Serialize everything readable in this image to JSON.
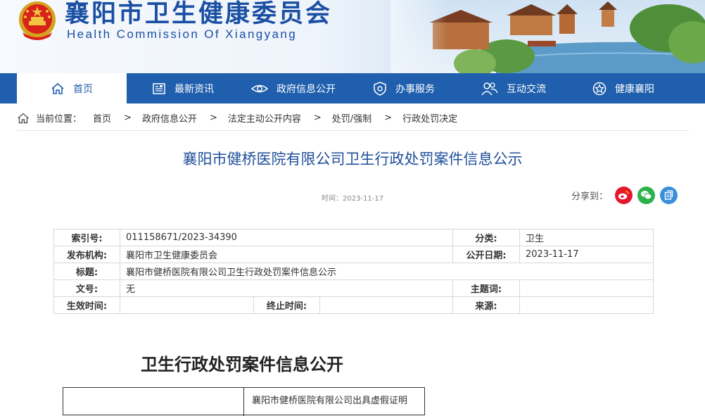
{
  "header": {
    "title": "襄阳市卫生健康委员会",
    "subtitle": "Health Commission Of Xiangyang"
  },
  "nav": {
    "items": [
      {
        "label": "首页",
        "icon": "home-icon",
        "active": true
      },
      {
        "label": "最新资讯",
        "icon": "news-icon",
        "active": false
      },
      {
        "label": "政府信息公开",
        "icon": "eye-icon",
        "active": false
      },
      {
        "label": "办事服务",
        "icon": "shield-icon",
        "active": false
      },
      {
        "label": "互动交流",
        "icon": "people-icon",
        "active": false
      },
      {
        "label": "健康襄阳",
        "icon": "star-badge-icon",
        "active": false
      }
    ]
  },
  "breadcrumb": {
    "label": "当前位置：",
    "items": [
      "首页",
      "政府信息公开",
      "法定主动公开内容",
      "处罚/强制",
      "行政处罚决定"
    ],
    "separator": ">"
  },
  "article": {
    "title": "襄阳市健桥医院有限公司卫生行政处罚案件信息公示",
    "time": "时间：2023-11-17",
    "share_label": "分享到："
  },
  "info": {
    "index_label": "索引号:",
    "index_value": "011158671/2023-34390",
    "category_label": "分类:",
    "category_value": "卫生",
    "publisher_label": "发布机构:",
    "publisher_value": "襄阳市卫生健康委员会",
    "date_label": "公开日期:",
    "date_value": "2023-11-17",
    "subject_label": "标题:",
    "subject_value": "襄阳市健桥医院有限公司卫生行政处罚案件信息公示",
    "docno_label": "文号:",
    "docno_value": "无",
    "topic_label": "主题词:",
    "topic_value": "",
    "effective_label": "生效时间:",
    "effective_value": "",
    "expire_label": "终止时间:",
    "expire_value": "",
    "source_label": "来源:",
    "source_value": ""
  },
  "body": {
    "heading": "卫生行政处罚案件信息公开",
    "table_partial_text": "襄阳市健桥医院有限公司出具虚假证明"
  },
  "colors": {
    "primary": "#1f5fad",
    "title_blue": "#1f4f9a",
    "weibo": "#e6162d",
    "wechat": "#2bb24c",
    "copy": "#3b8fd9"
  }
}
